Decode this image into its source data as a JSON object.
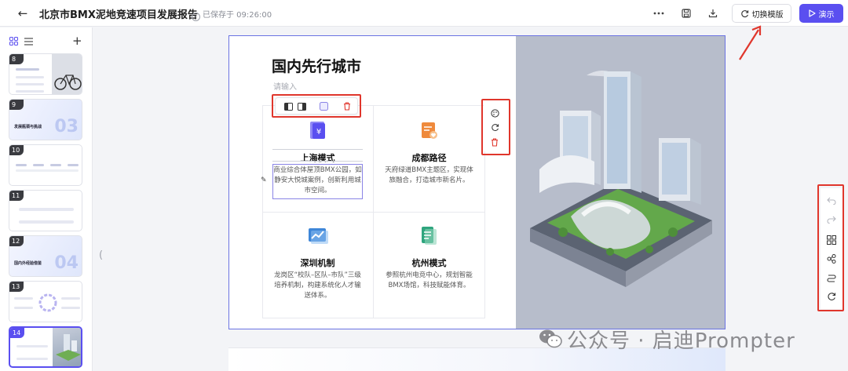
{
  "topbar": {
    "title": "北京市BMX泥地竞速项目发展报告",
    "save_status": "已保存于 09:26:00",
    "switch_template_label": "切换模版",
    "present_label": "演示"
  },
  "sidebar": {
    "thumbnails": [
      {
        "num": "8",
        "title": ""
      },
      {
        "num": "9",
        "title": "发展瓶颈与挑战",
        "big": "03"
      },
      {
        "num": "10",
        "title": ""
      },
      {
        "num": "11",
        "title": ""
      },
      {
        "num": "12",
        "title": "国内外经验借鉴",
        "big": "04"
      },
      {
        "num": "13",
        "title": ""
      },
      {
        "num": "14",
        "title": ""
      }
    ]
  },
  "slide": {
    "title": "国内先行城市",
    "placeholder": "请输入",
    "cards": [
      {
        "title": "上海模式",
        "desc": "商业综合体屋顶BMX公园，如静安大悦城案例，创新利用城市空间。",
        "icon": "id-card-icon",
        "color": "#5a4ff0"
      },
      {
        "title": "成都路径",
        "desc": "天府绿道BMX主题区，实现体旅融合，打造城市新名片。",
        "icon": "heart-document-icon",
        "color": "#ef8a3c"
      },
      {
        "title": "深圳机制",
        "desc": "龙岗区“校队–区队–市队”三级培养机制，构建系统化人才输送体系。",
        "icon": "chart-trend-icon",
        "color": "#3e86d8"
      },
      {
        "title": "杭州模式",
        "desc": "参照杭州电竞中心，规划智能BMX场馆，科技赋能体育。",
        "icon": "document-list-icon",
        "color": "#2fa57e"
      }
    ]
  },
  "watermark": {
    "text": "公众号 · 启迪Prompter"
  },
  "colors": {
    "accent": "#5a4ff0",
    "annotation_red": "#e0362c"
  }
}
